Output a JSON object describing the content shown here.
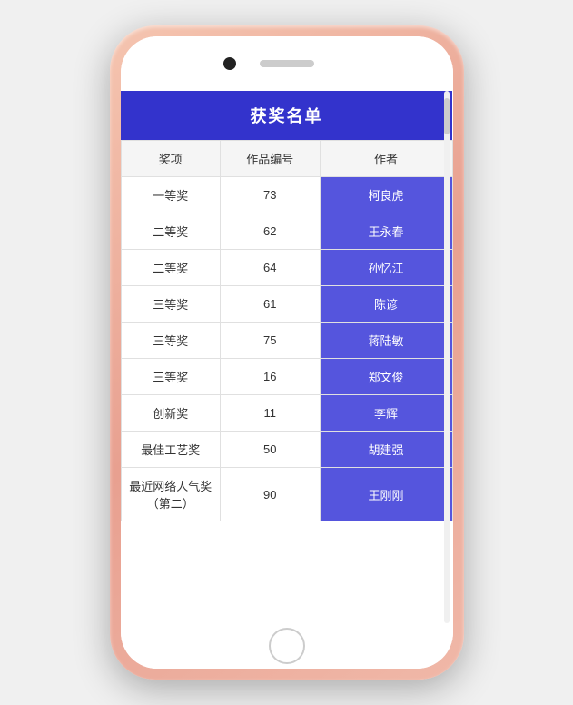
{
  "phone": {
    "title": "获奖名单"
  },
  "table": {
    "title": "获奖名单",
    "headers": [
      "奖项",
      "作品编号",
      "作者"
    ],
    "rows": [
      {
        "prize": "一等奖",
        "number": "73",
        "author": "柯良虎"
      },
      {
        "prize": "二等奖",
        "number": "62",
        "author": "王永春"
      },
      {
        "prize": "二等奖",
        "number": "64",
        "author": "孙忆江"
      },
      {
        "prize": "三等奖",
        "number": "61",
        "author": "陈谚"
      },
      {
        "prize": "三等奖",
        "number": "75",
        "author": "蒋陆敏"
      },
      {
        "prize": "三等奖",
        "number": "16",
        "author": "郑文俊"
      },
      {
        "prize": "创新奖",
        "number": "11",
        "author": "李辉"
      },
      {
        "prize": "最佳工艺奖",
        "number": "50",
        "author": "胡建强"
      },
      {
        "prize": "最近网络人气奖（第二）",
        "number": "90",
        "author": "王刚刚"
      }
    ]
  }
}
